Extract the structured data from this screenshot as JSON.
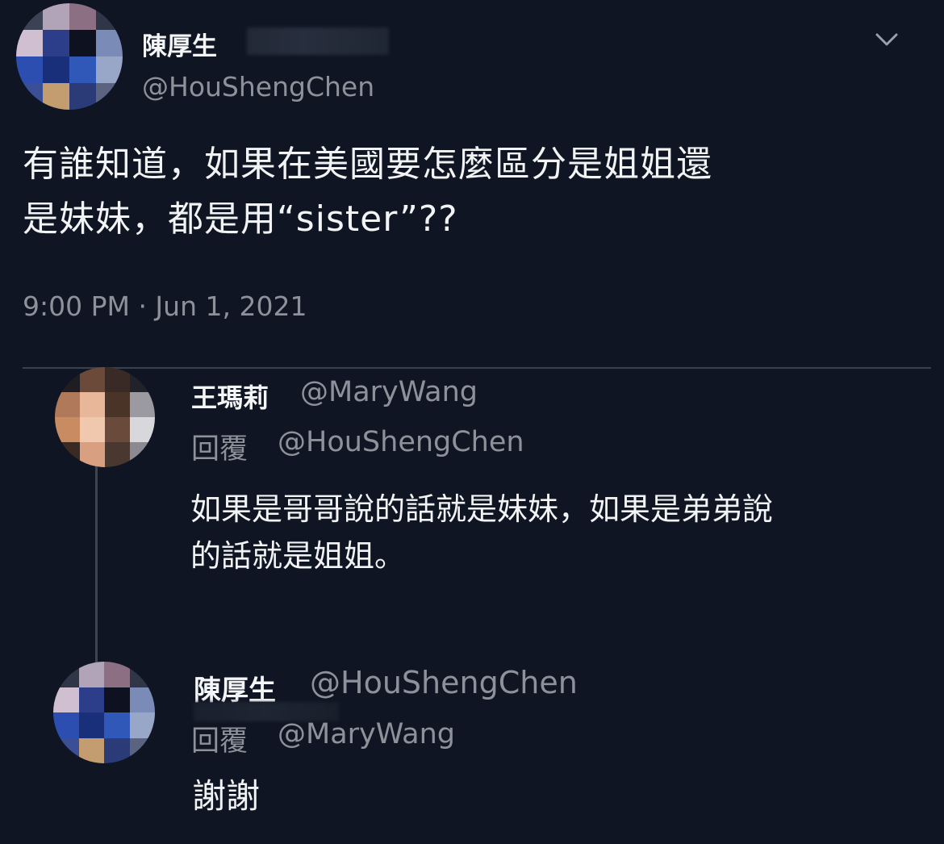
{
  "main_tweet": {
    "display_name": "陳厚生",
    "handle": "@HouShengChen",
    "text": "有誰知道，如果在美國要怎麼區分是姐姐還\n是妹妹，都是用“sister”??",
    "timestamp": "9:00 PM · Jun 1, 2021",
    "menu_icon": "chevron-down-icon"
  },
  "replies": [
    {
      "display_name": "王瑪莉",
      "handle": "@MaryWang",
      "reply_to_label": "回覆",
      "reply_to_handle": "@HouShengChen",
      "text": "如果是哥哥說的話就是妹妹，如果是弟弟說\n的話就是姐姐。"
    },
    {
      "display_name": "陳厚生",
      "handle": "@HouShengChen",
      "reply_to_label": "回覆",
      "reply_to_handle": "@MaryWang",
      "text": "謝謝"
    }
  ],
  "colors": {
    "background": "#0f1522",
    "primary_text": "#f2f3f4",
    "secondary_text": "#8d929a",
    "divider": "#3a414d"
  }
}
